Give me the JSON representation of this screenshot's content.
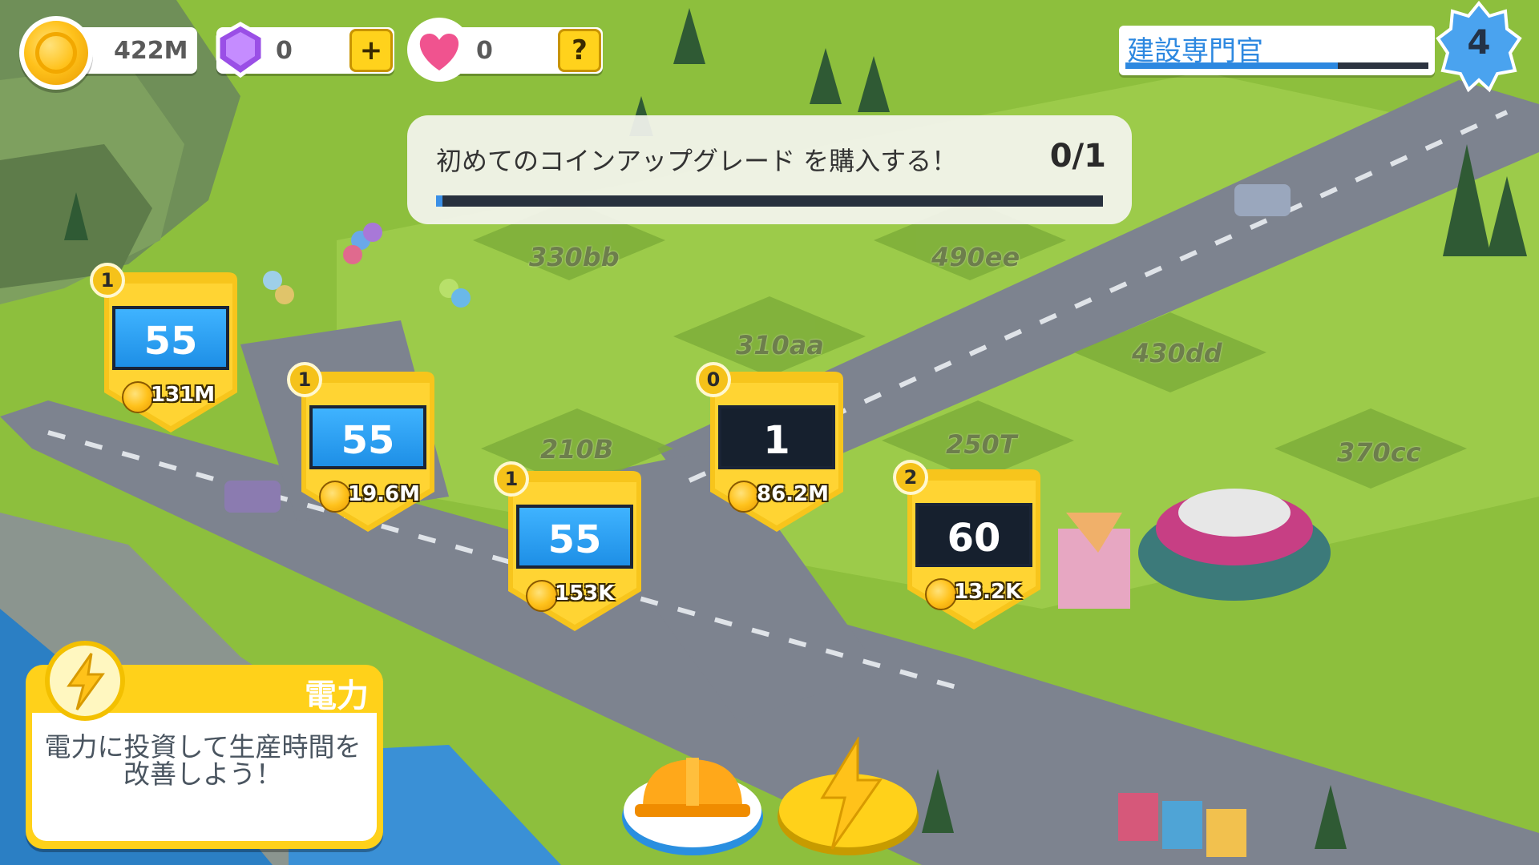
{
  "currency": {
    "coins": "422M",
    "gems": "0",
    "hearts": "0",
    "add_button_label": "+",
    "help_button_label": "?"
  },
  "title": {
    "name": "建設専門官",
    "level": "4",
    "progress": 0.7
  },
  "quest": {
    "text": "初めてのコインアップグレード を購入する！",
    "count": "0/1",
    "progress": 0.01
  },
  "plots": [
    {
      "label": "330bb"
    },
    {
      "label": "490ee"
    },
    {
      "label": "310aa"
    },
    {
      "label": "430dd"
    },
    {
      "label": "210B"
    },
    {
      "label": "250T"
    },
    {
      "label": "370cc"
    }
  ],
  "businesses": [
    {
      "count": "1",
      "level": "55",
      "cost": "131M",
      "style": "blue"
    },
    {
      "count": "1",
      "level": "55",
      "cost": "19.6M",
      "style": "blue"
    },
    {
      "count": "1",
      "level": "55",
      "cost": "153K",
      "style": "blue"
    },
    {
      "count": "0",
      "level": "1",
      "cost": "86.2M",
      "style": "dark"
    },
    {
      "count": "2",
      "level": "60",
      "cost": "13.2K",
      "style": "dark"
    }
  ],
  "power_card": {
    "title": "電力",
    "description": "電力に投資して生産時間を改善しよう！"
  },
  "icons": {
    "coin": "coin-icon",
    "gem": "gem-icon",
    "heart": "heart-icon",
    "level": "star-badge-icon",
    "build": "hard-hat-icon",
    "power": "lightning-bolt-icon"
  },
  "colors": {
    "grass": "#8cbf3c",
    "road": "#7f8591",
    "accent_yellow": "#ffd11a",
    "accent_blue": "#2d88e0",
    "water": "#2b7fc4"
  }
}
